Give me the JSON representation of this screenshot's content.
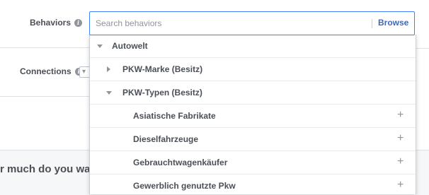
{
  "background_fragment": {
    "question_text": "r much do you wa"
  },
  "fields": {
    "behaviors_label": "Behaviors",
    "connections_label": "Connections"
  },
  "search": {
    "placeholder": "Search behaviors",
    "value": "",
    "browse_label": "Browse"
  },
  "dropdown": {
    "items": [
      {
        "label": "Autowelt",
        "level": 0,
        "state": "expanded"
      },
      {
        "label": "PKW-Marke (Besitz)",
        "level": 1,
        "state": "collapsed"
      },
      {
        "label": "PKW-Typen (Besitz)",
        "level": 1,
        "state": "expanded"
      },
      {
        "label": "Asiatische Fabrikate",
        "level": 2,
        "action": "add"
      },
      {
        "label": "Dieselfahrzeuge",
        "level": 2,
        "action": "add"
      },
      {
        "label": "Gebrauchtwagenkäufer",
        "level": 2,
        "action": "add"
      },
      {
        "label": "Gewerblich genutzte Pkw",
        "level": 2,
        "action": "add"
      }
    ]
  },
  "icons": {
    "info": "info-icon",
    "expand": "caret-down-icon",
    "collapsed": "caret-right-icon",
    "add": "plus-icon"
  },
  "colors": {
    "accent": "#4267b2",
    "focus_border": "#4080ff",
    "label_text": "#4b4f56",
    "muted": "#90949c"
  }
}
